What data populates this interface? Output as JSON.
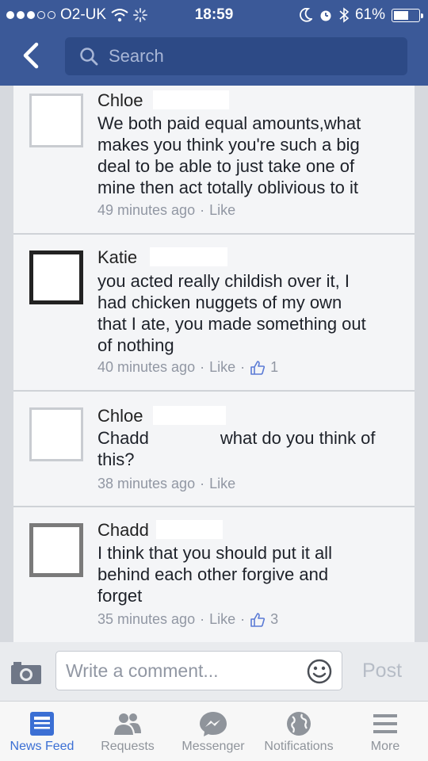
{
  "status_bar": {
    "carrier": "O2-UK",
    "time": "18:59",
    "battery": "61%",
    "battery_level": 0.61
  },
  "header": {
    "search_placeholder": "Search"
  },
  "comments": [
    {
      "name": "Chloe",
      "text": [
        "We both paid equal amounts,what",
        "makes you think you're such a big",
        "deal to be able to just take one of",
        "mine then act totally oblivious to it"
      ],
      "time": "49 minutes ago",
      "like_label": "Like",
      "likes": ""
    },
    {
      "name": "Katie",
      "text": [
        "you acted really childish over it, I",
        "had chicken nuggets of my own",
        "that I ate, you made something out",
        "of nothing"
      ],
      "time": "40 minutes ago",
      "like_label": "Like",
      "likes": "1"
    },
    {
      "name": "Chloe",
      "mention": "Chadd",
      "text": [
        "what do you think of",
        "this?"
      ],
      "time": "38 minutes ago",
      "like_label": "Like",
      "likes": ""
    },
    {
      "name": "Chadd",
      "text": [
        "I think that you should put it all",
        "behind each other forgive and",
        "forget"
      ],
      "time": "35 minutes ago",
      "like_label": "Like",
      "likes": "3"
    }
  ],
  "composer": {
    "placeholder": "Write a comment...",
    "post_label": "Post"
  },
  "tabs": [
    {
      "label": "News Feed",
      "icon": "news-feed-icon",
      "active": true
    },
    {
      "label": "Requests",
      "icon": "friend-requests-icon",
      "active": false
    },
    {
      "label": "Messenger",
      "icon": "messenger-icon",
      "active": false
    },
    {
      "label": "Notifications",
      "icon": "globe-icon",
      "active": false
    },
    {
      "label": "More",
      "icon": "menu-icon",
      "active": false
    }
  ],
  "colors": {
    "brand": "#3b5998",
    "tab_active": "#3b6fd4",
    "meta_text": "#9197a3"
  }
}
